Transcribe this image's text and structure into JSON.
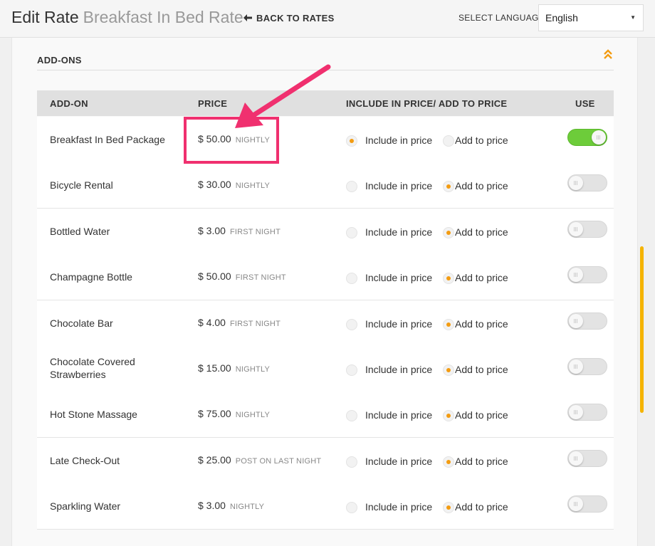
{
  "header": {
    "title": "Edit Rate",
    "subtitle": "Breakfast In Bed Rate",
    "back_label": "BACK TO RATES",
    "language_label": "SELECT LANGUAGE",
    "language_value": "English"
  },
  "section": {
    "title": "ADD-ONS"
  },
  "table": {
    "columns": [
      "ADD-ON",
      "PRICE",
      "INCLUDE IN PRICE/ ADD TO PRICE",
      "USE"
    ],
    "include_label": "Include in price",
    "add_label": "Add to price",
    "rows": [
      {
        "name": "Breakfast In Bed Package",
        "price": "$ 50.00",
        "frequency": "NIGHTLY",
        "mode": "include",
        "use": true
      },
      {
        "name": "Bicycle Rental",
        "price": "$ 30.00",
        "frequency": "NIGHTLY",
        "mode": "add",
        "use": false
      },
      {
        "name": "Bottled Water",
        "price": "$ 3.00",
        "frequency": "FIRST NIGHT",
        "mode": "add",
        "use": false
      },
      {
        "name": "Champagne Bottle",
        "price": "$ 50.00",
        "frequency": "FIRST NIGHT",
        "mode": "add",
        "use": false
      },
      {
        "name": "Chocolate Bar",
        "price": "$ 4.00",
        "frequency": "FIRST NIGHT",
        "mode": "add",
        "use": false
      },
      {
        "name": "Chocolate Covered Strawberries",
        "price": "$ 15.00",
        "frequency": "NIGHTLY",
        "mode": "add",
        "use": false
      },
      {
        "name": "Hot Stone Massage",
        "price": "$ 75.00",
        "frequency": "NIGHTLY",
        "mode": "add",
        "use": false
      },
      {
        "name": "Late Check-Out",
        "price": "$ 25.00",
        "frequency": "POST ON LAST NIGHT",
        "mode": "add",
        "use": false
      },
      {
        "name": "Sparkling Water",
        "price": "$ 3.00",
        "frequency": "NIGHTLY",
        "mode": "add",
        "use": false
      }
    ]
  },
  "icons": {
    "back": "arrow-left-icon",
    "collapse": "chevrons-up-icon",
    "dropdown": "caret-down-icon"
  },
  "colors": {
    "accent": "#f39c12",
    "toggle_on": "#6dcc3a",
    "annotation": "#f0306f",
    "scrollbar": "#f5b400"
  }
}
